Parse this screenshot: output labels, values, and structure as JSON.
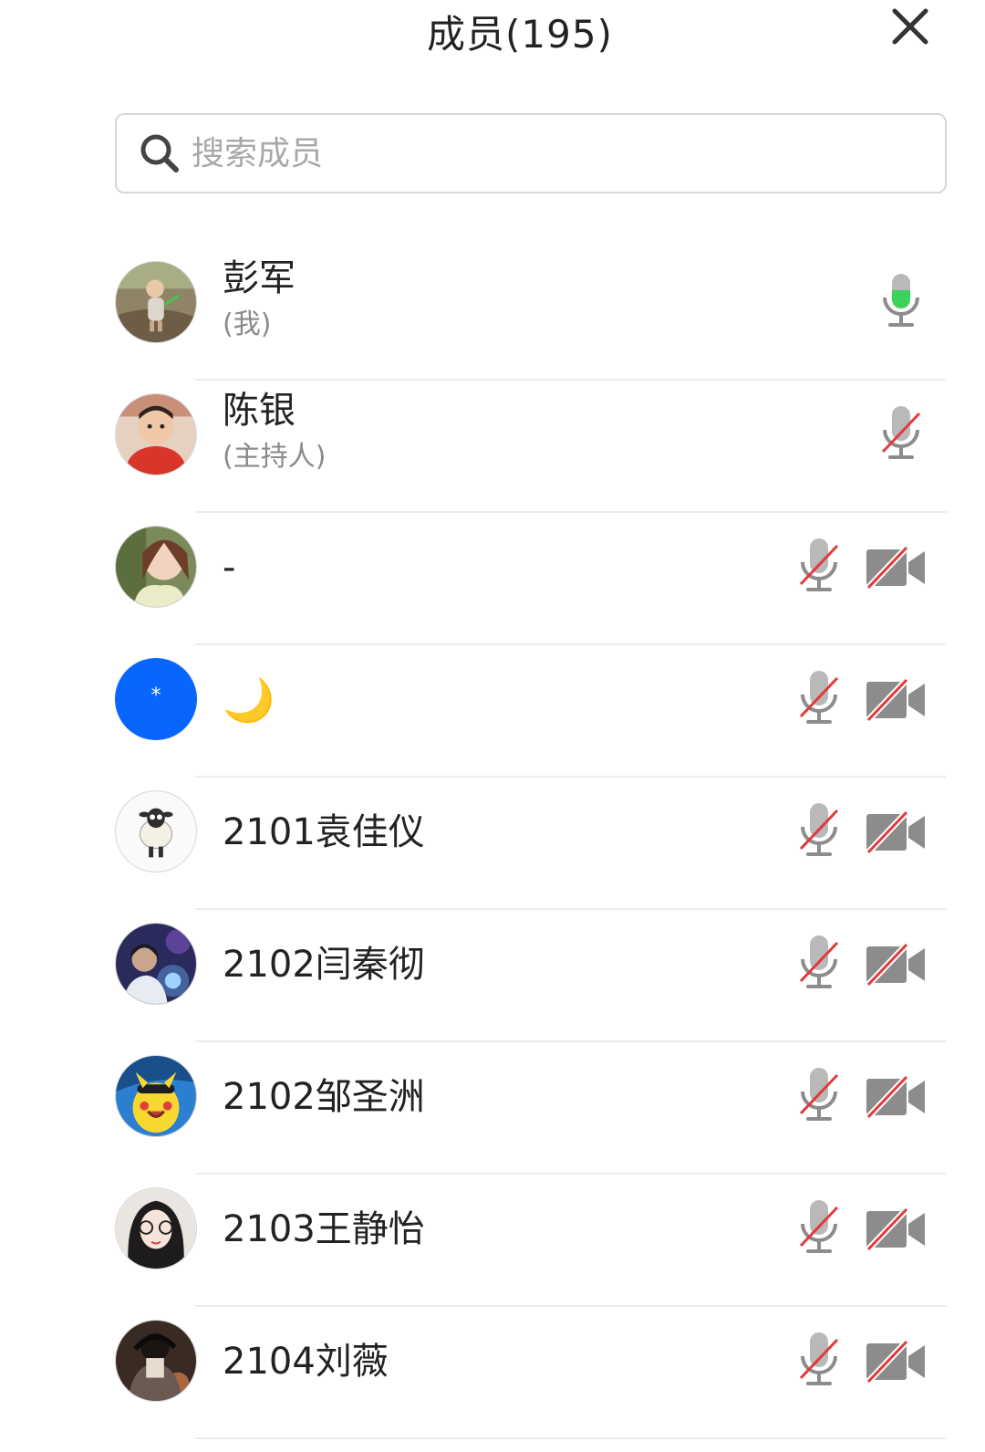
{
  "header": {
    "title": "成员(195)"
  },
  "search": {
    "placeholder": "搜索成员"
  },
  "members": [
    {
      "name": "彭军",
      "role": "(我)",
      "mic": "active",
      "camera": null,
      "avatar": "photo-toddler-outdoor"
    },
    {
      "name": "陈银",
      "role": "(主持人)",
      "mic": "muted",
      "camera": null,
      "avatar": "photo-boy-red-shirt"
    },
    {
      "name": "-",
      "role": "",
      "mic": "muted",
      "camera": "off",
      "avatar": "photo-girl-selfie"
    },
    {
      "name": "🌙",
      "role": "",
      "mic": "muted",
      "camera": "off",
      "avatar": "blue-dot-star",
      "avatar_text": "*",
      "avatar_color": "#0866ff"
    },
    {
      "name": "2101袁佳仪",
      "role": "",
      "mic": "muted",
      "camera": "off",
      "avatar": "cartoon-sheep"
    },
    {
      "name": "2102闫秦彻",
      "role": "",
      "mic": "muted",
      "camera": "off",
      "avatar": "photo-concert-stage"
    },
    {
      "name": "2102邹圣洲",
      "role": "",
      "mic": "muted",
      "camera": "off",
      "avatar": "cartoon-pikachu"
    },
    {
      "name": "2103王静怡",
      "role": "",
      "mic": "muted",
      "camera": "off",
      "avatar": "photo-girl-glasses"
    },
    {
      "name": "2104刘薇",
      "role": "",
      "mic": "muted",
      "camera": "off",
      "avatar": "photo-dark-portrait"
    }
  ],
  "colors": {
    "mic_active": "#3cd15a",
    "strike": "#e23a3a",
    "icon_gray": "#8c8c8c",
    "accent_blue": "#0866ff"
  }
}
